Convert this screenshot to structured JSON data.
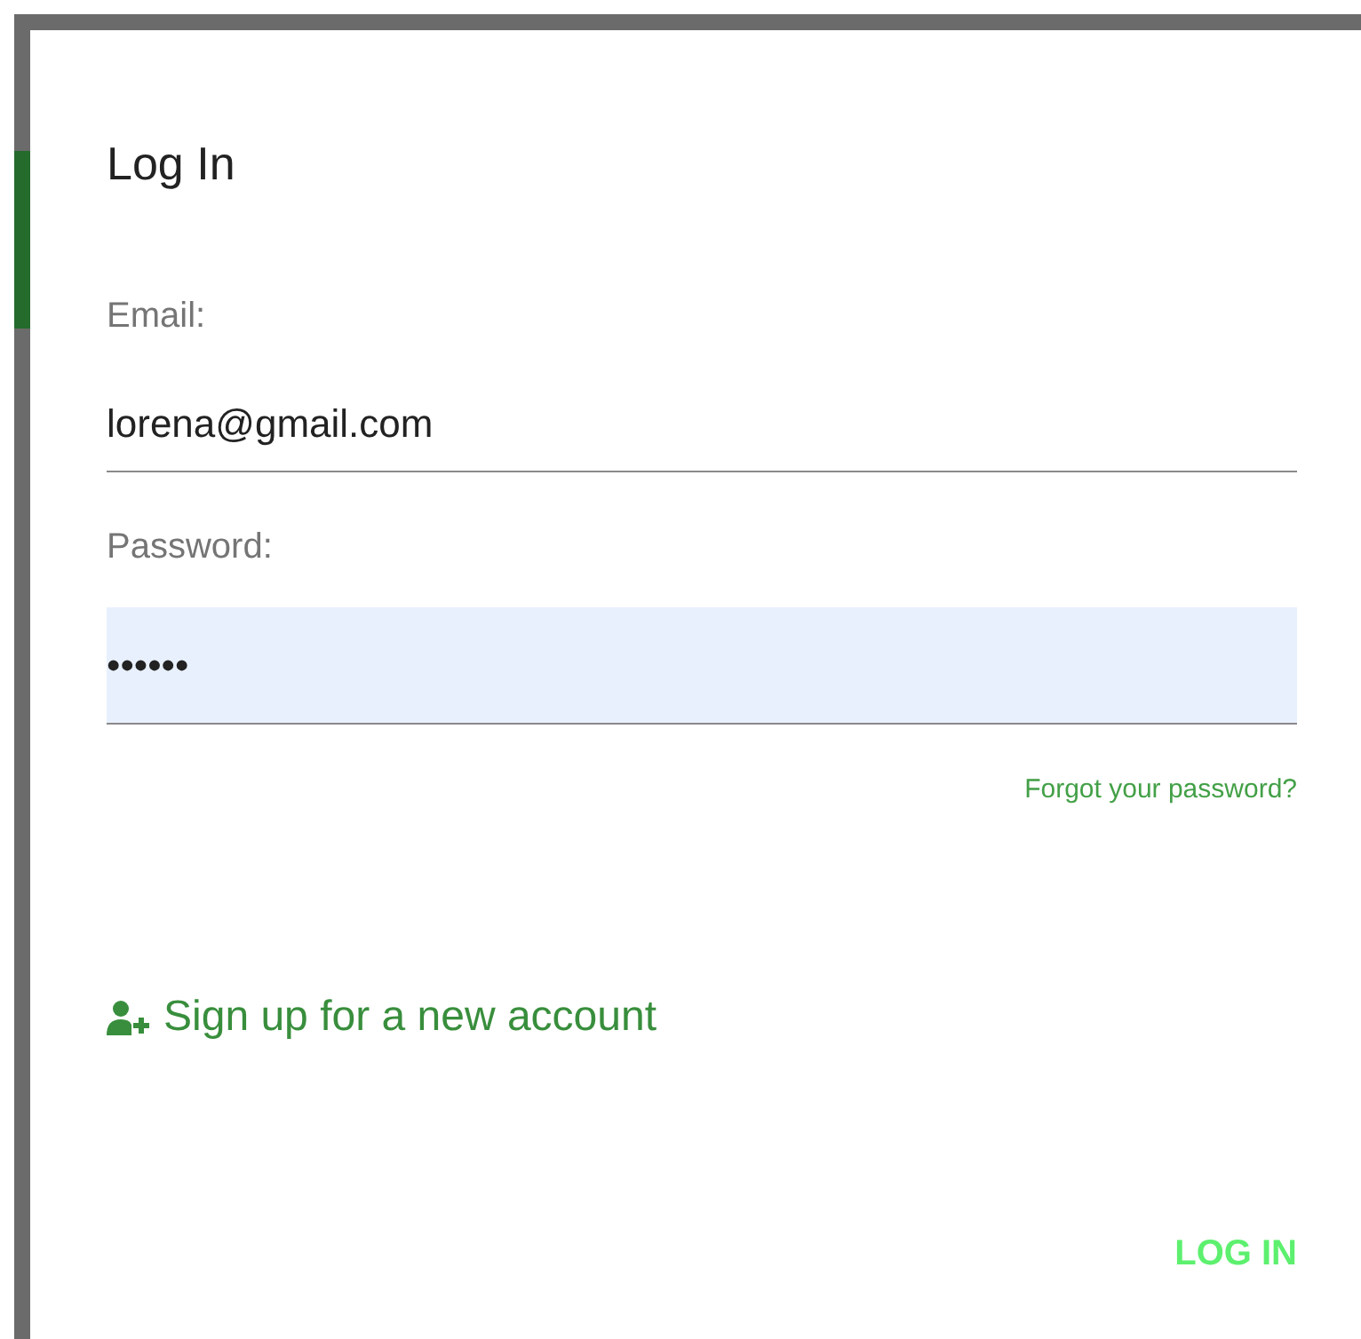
{
  "dialog": {
    "title": "Log In"
  },
  "fields": [
    {
      "label": "Email:",
      "value": "lorena@gmail.com",
      "autofilled": false
    },
    {
      "label": "Password:",
      "value": "••••••",
      "autofilled": true
    }
  ],
  "forgot_link": "Forgot your password?",
  "signup_link": "Sign up for a new account",
  "buttons": [
    "LOG IN"
  ]
}
